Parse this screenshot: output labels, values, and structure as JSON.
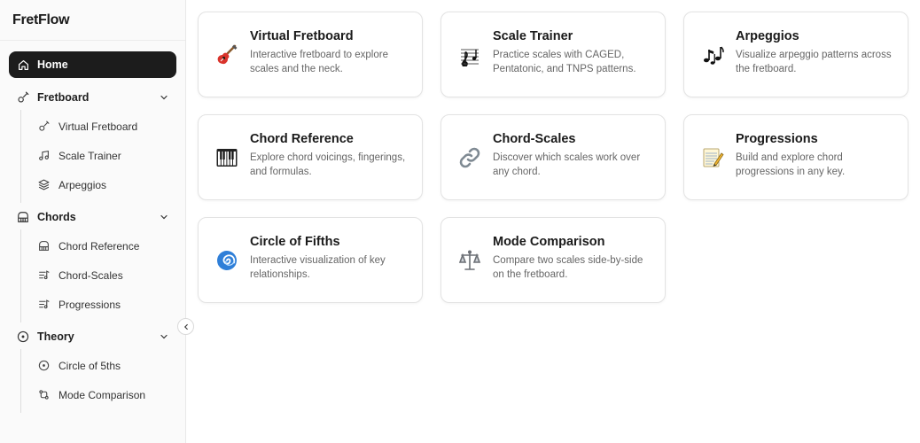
{
  "app": {
    "brand": "FretFlow"
  },
  "sidebar": {
    "home": {
      "label": "Home",
      "icon": "home-icon"
    },
    "groups": [
      {
        "label": "Fretboard",
        "icon": "guitar-icon",
        "items": [
          {
            "label": "Virtual Fretboard",
            "icon": "guitar-icon"
          },
          {
            "label": "Scale Trainer",
            "icon": "music-note-icon"
          },
          {
            "label": "Arpeggios",
            "icon": "layers-icon"
          }
        ]
      },
      {
        "label": "Chords",
        "icon": "piano-icon",
        "items": [
          {
            "label": "Chord Reference",
            "icon": "piano-icon"
          },
          {
            "label": "Chord-Scales",
            "icon": "list-music-icon"
          },
          {
            "label": "Progressions",
            "icon": "list-music-icon"
          }
        ]
      },
      {
        "label": "Theory",
        "icon": "circle-dot-icon",
        "items": [
          {
            "label": "Circle of 5ths",
            "icon": "circle-dot-icon"
          },
          {
            "label": "Mode Comparison",
            "icon": "git-compare-icon"
          }
        ]
      }
    ]
  },
  "cards": [
    {
      "title": "Virtual Fretboard",
      "desc": "Interactive fretboard to explore scales and the neck.",
      "icon": "guitar-emoji",
      "glyph": "🎸"
    },
    {
      "title": "Scale Trainer",
      "desc": "Practice scales with CAGED, Pentatonic, and TNPS patterns.",
      "icon": "score-emoji",
      "glyph": "🎼"
    },
    {
      "title": "Arpeggios",
      "desc": "Visualize arpeggio patterns across the fretboard.",
      "icon": "notes-emoji",
      "glyph": "🎶"
    },
    {
      "title": "Chord Reference",
      "desc": "Explore chord voicings, fingerings, and formulas.",
      "icon": "keyboard-emoji",
      "glyph": "🎹"
    },
    {
      "title": "Chord-Scales",
      "desc": "Discover which scales work over any chord.",
      "icon": "link-emoji",
      "glyph": "🔗"
    },
    {
      "title": "Progressions",
      "desc": "Build and explore chord progressions in any key.",
      "icon": "memo-emoji",
      "glyph": "📝"
    },
    {
      "title": "Circle of Fifths",
      "desc": "Interactive visualization of key relationships.",
      "icon": "cyclone-emoji",
      "glyph": "🌀"
    },
    {
      "title": "Mode Comparison",
      "desc": "Compare two scales side-by-side on the fretboard.",
      "icon": "scales-emoji",
      "glyph": "⚖️"
    }
  ]
}
